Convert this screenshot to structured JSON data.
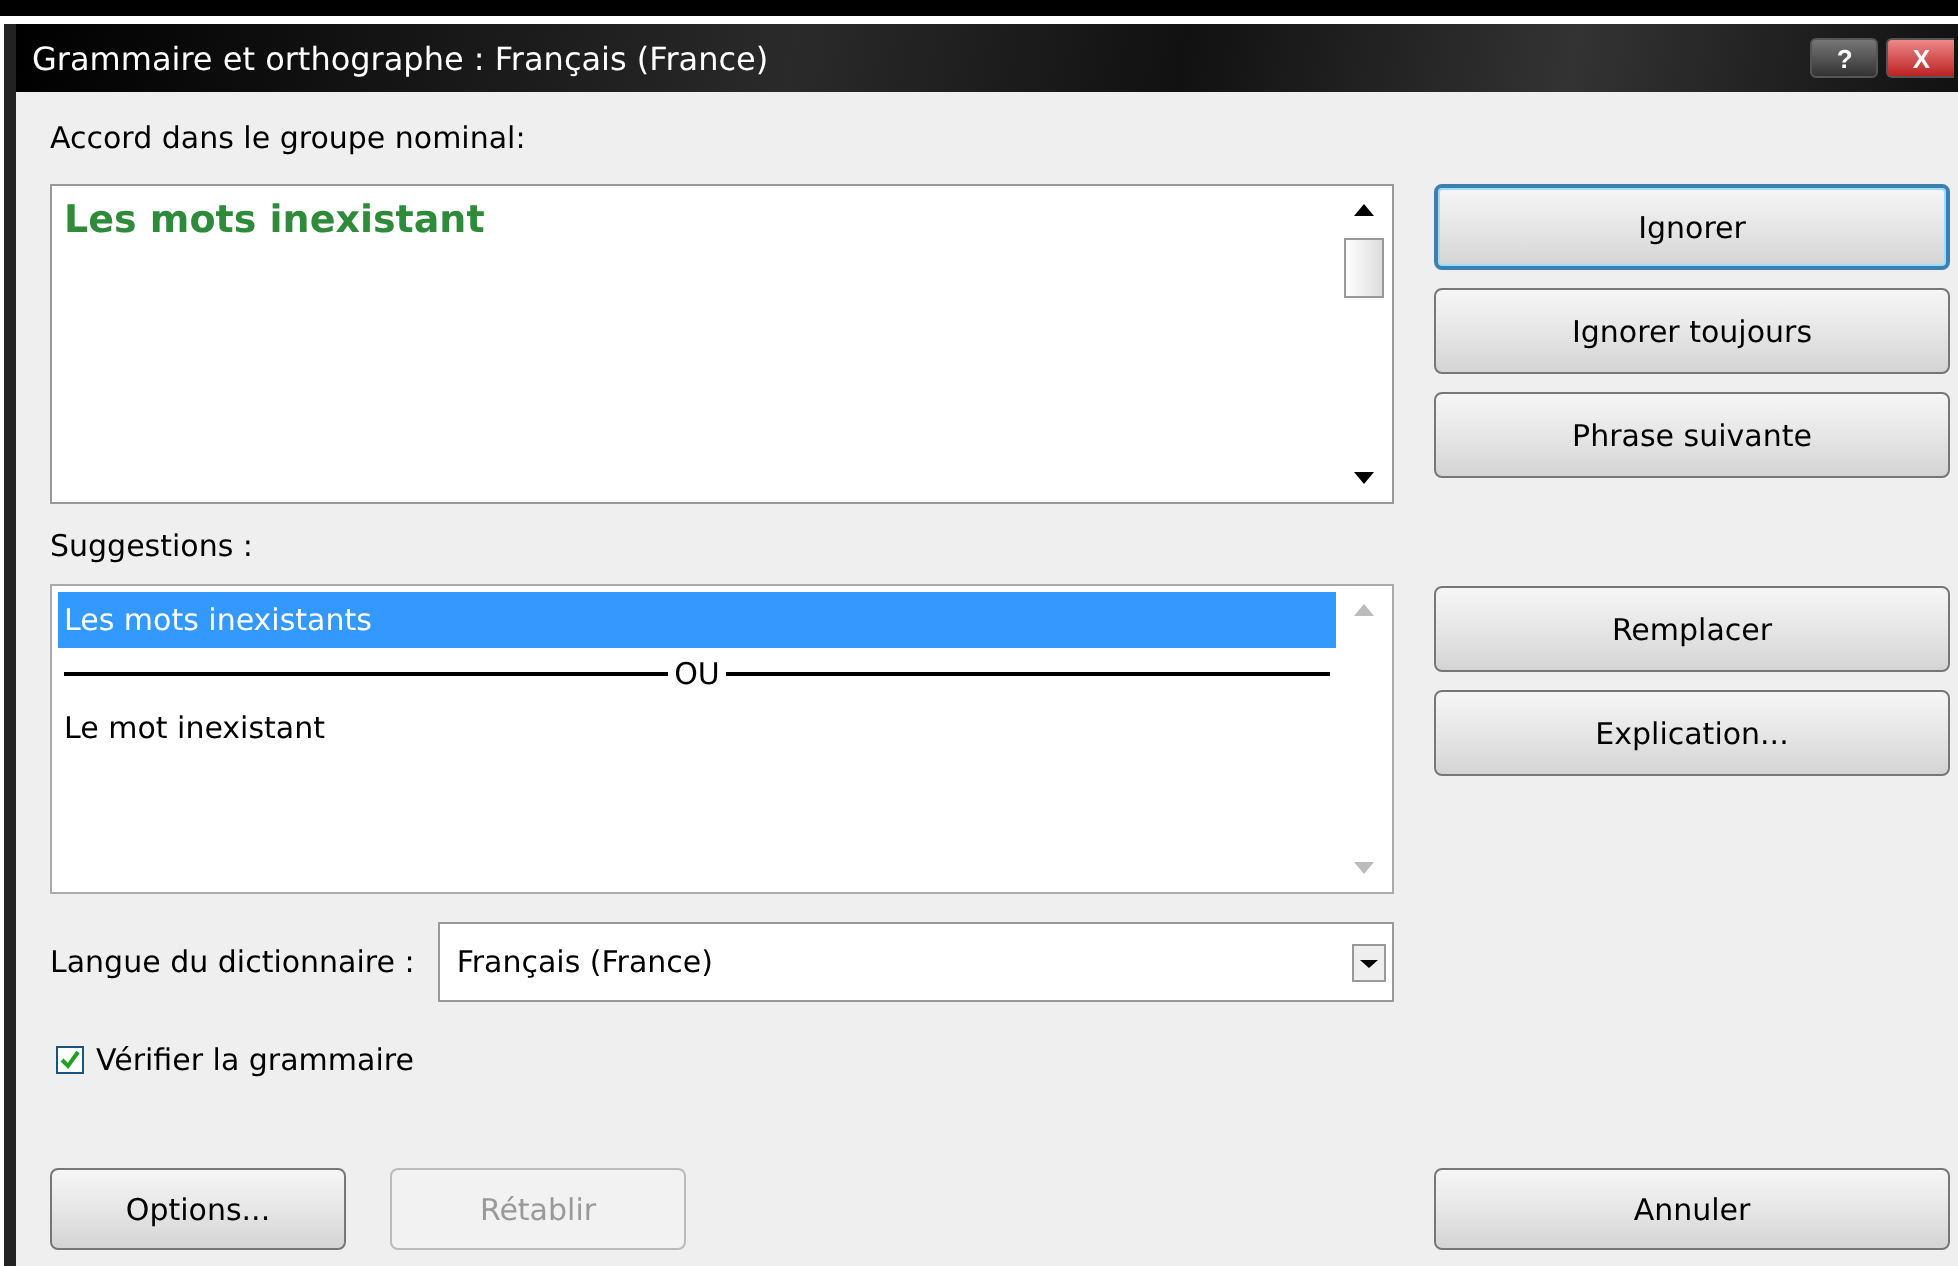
{
  "window": {
    "title": "Grammaire et orthographe : Français (France)",
    "controls": [
      "?",
      "X"
    ]
  },
  "error": {
    "label": "Accord dans le groupe nominal:",
    "text": "Les mots inexistant"
  },
  "suggestions": {
    "label": "Suggestions :",
    "items": [
      {
        "kind": "item",
        "text": "Les mots inexistants",
        "selected": true
      },
      {
        "kind": "separator",
        "text": "OU"
      },
      {
        "kind": "item",
        "text": "Le mot inexistant",
        "selected": false
      }
    ]
  },
  "side_buttons_top": [
    {
      "label": "Ignorer",
      "focused": true
    },
    {
      "label": "Ignorer toujours",
      "focused": false
    },
    {
      "label": "Phrase suivante",
      "focused": false
    }
  ],
  "side_buttons_bottom": [
    {
      "label": "Remplacer",
      "focused": false
    },
    {
      "label": "Explication...",
      "focused": false
    }
  ],
  "dictionary": {
    "label": "Langue du dictionnaire :",
    "value": "Français (France)"
  },
  "check_grammar": {
    "label": "Vérifier la grammaire",
    "checked": true
  },
  "bottom_buttons": [
    {
      "label": "Options...",
      "disabled": false
    },
    {
      "label": "Rétablir",
      "disabled": true
    }
  ],
  "cancel_button": {
    "label": "Annuler"
  }
}
